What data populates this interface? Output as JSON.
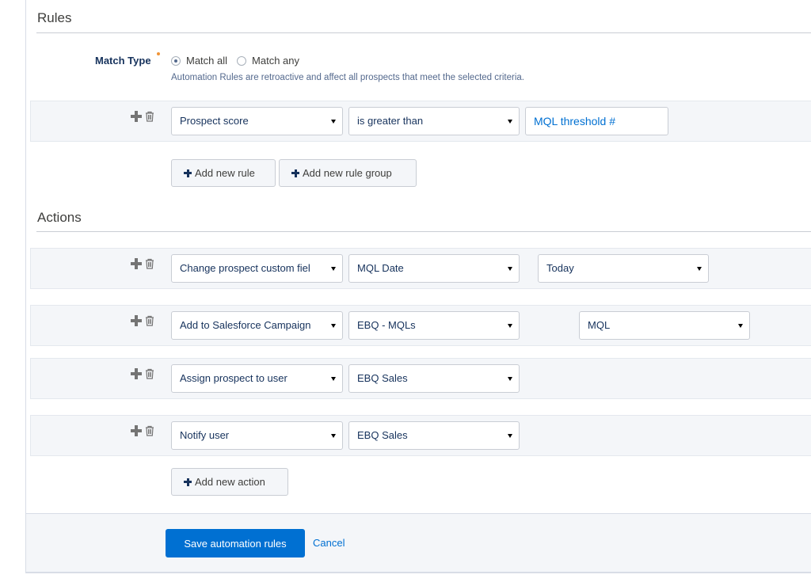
{
  "rules": {
    "title": "Rules",
    "match_type_label": "Match Type",
    "match_options": [
      "Match all",
      "Match any"
    ],
    "selected_match": "Match all",
    "help_text": "Automation Rules are retroactive and affect all prospects that meet the selected criteria.",
    "rule": {
      "field": "Prospect score",
      "operator": "is greater than",
      "value_placeholder": "MQL threshold #"
    },
    "add_rule_label": "Add new rule",
    "add_rule_group_label": "Add new rule group"
  },
  "actions": {
    "title": "Actions",
    "items": [
      {
        "action": "Change prospect custom fiel",
        "target": "MQL Date",
        "extra": "Today"
      },
      {
        "action": "Add to Salesforce Campaign",
        "target": "EBQ - MQLs",
        "extra": "MQL"
      },
      {
        "action": "Assign prospect to user",
        "target": "EBQ Sales"
      },
      {
        "action": "Notify user",
        "target": "EBQ Sales"
      }
    ],
    "add_action_label": "Add new action"
  },
  "footer": {
    "save_label": "Save automation rules",
    "cancel_label": "Cancel"
  },
  "colors": {
    "brand": "#0070d2",
    "row_bg": "#f4f6f9",
    "required": "#f09437"
  },
  "icons": [
    "add-icon",
    "trash-icon",
    "caret-down-icon"
  ]
}
